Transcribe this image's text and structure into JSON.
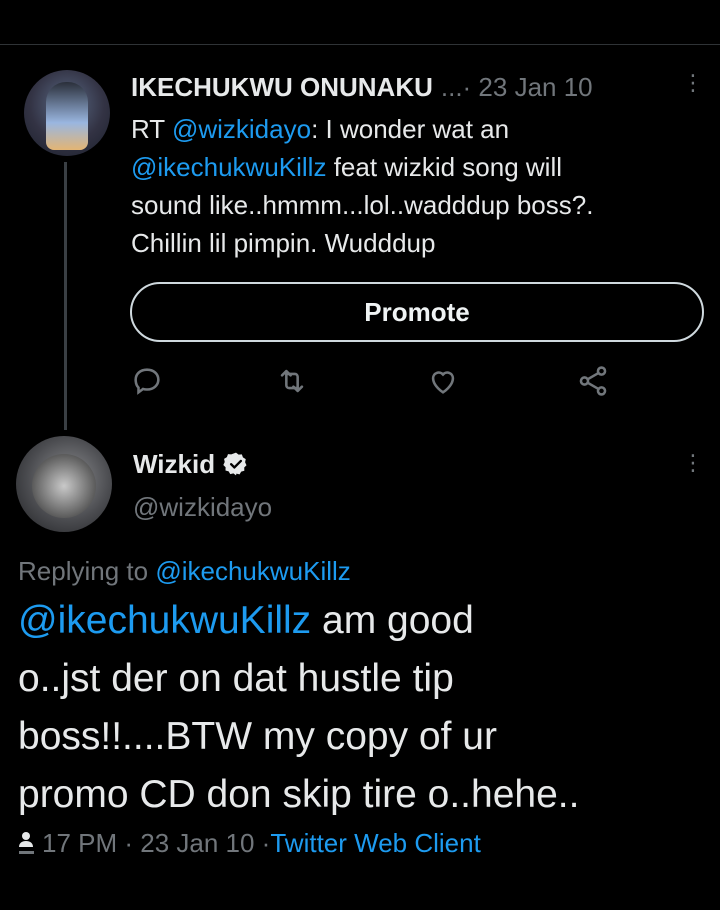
{
  "tweet1": {
    "author": "IKECHUKWU ONUNAKU",
    "meta": "...· 23 Jan 10",
    "lines": [
      [
        {
          "t": "RT "
        },
        {
          "t": "@wizkidayo",
          "m": true
        },
        {
          "t": ": I wonder wat an"
        }
      ],
      [
        {
          "t": "@ikechukwuKillz",
          "m": true
        },
        {
          "t": " feat wizkid song will"
        }
      ],
      [
        {
          "t": "sound like..hmmm...lol..wadddup boss?."
        }
      ],
      [
        {
          "t": "Chillin lil pimpin. Wudddup"
        }
      ]
    ],
    "promote_label": "Promote",
    "actions": [
      "reply-icon",
      "retweet-icon",
      "like-icon",
      "share-icon"
    ]
  },
  "tweet2": {
    "author": "Wizkid",
    "handle": "@wizkidayo",
    "replying_prefix": "Replying to ",
    "replying_to": "@ikechukwuKillz",
    "lines": [
      [
        {
          "t": "@ikechukwuKillz",
          "m": true
        },
        {
          "t": " am good"
        }
      ],
      [
        {
          "t": "o..jst der on dat hustle tip"
        }
      ],
      [
        {
          "t": "boss!!....BTW my copy of ur"
        }
      ],
      [
        {
          "t": "promo CD don skip tire o..hehe.."
        }
      ]
    ],
    "time": "17 PM · 23 Jan 10 · ",
    "client": "Twitter Web Client"
  },
  "colors": {
    "accent": "#1d9bf0",
    "secondary_text": "#71767b",
    "background": "#000000"
  }
}
